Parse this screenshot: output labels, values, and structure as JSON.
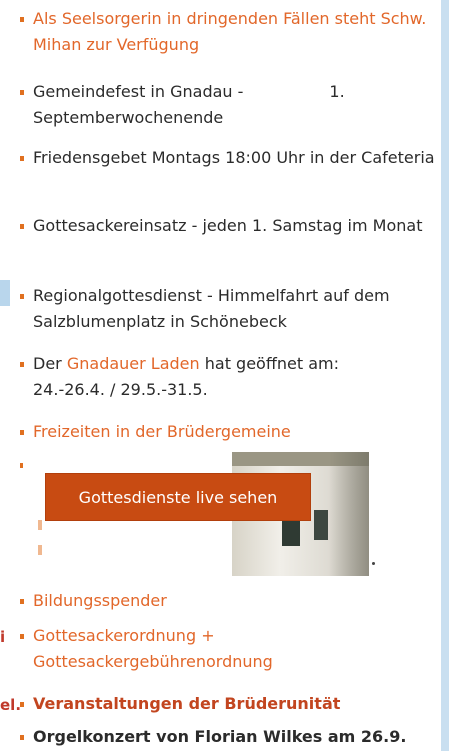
{
  "items": [
    {
      "text": "Als Seelsorgerin in dringenden Fällen steht Schw. Mihan zur Verfügung"
    },
    {
      "text_a": "Gemeindefest in Gnadau -",
      "text_b": "1.",
      "text_c": "Septemberwochenende"
    },
    {
      "text": "Friedensgebet Montags 18:00 Uhr in der Cafeteria"
    },
    {
      "text": "Gottesackereinsatz - jeden 1. Samstag im Monat"
    },
    {
      "text": "Regionalgottesdienst - Himmelfahrt auf dem Salzblumenplatz in Schönebeck"
    },
    {
      "prefix": "Der",
      "link": "Gnadauer Laden",
      "suffix": "hat geöffnet am:",
      "dates": "24.-26.4. / 29.5.-31.5."
    },
    {
      "text": "Freizeiten in der Brüdergemeine"
    },
    {
      "text": "Bildungsspender"
    },
    {
      "line1": "Gottesackerordnung +",
      "line2": "Gottesackergebührenordnung"
    },
    {
      "text": "Veranstaltungen der Brüderunität"
    },
    {
      "text": "Orgelkonzert von Florian Wilkes am 26.9."
    }
  ],
  "live_button": {
    "label": "Gottesdienste live sehen"
  },
  "left_edge": {
    "char1": "i",
    "char2": "el."
  },
  "colors": {
    "accent": "#e2672a",
    "button": "#c84b12",
    "text": "#2b2b2b"
  }
}
